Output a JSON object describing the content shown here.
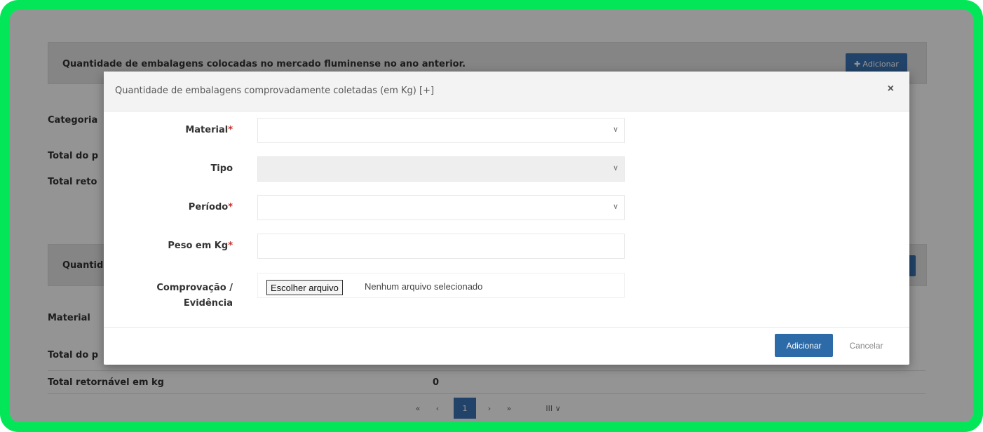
{
  "background": {
    "panel1_title": "Quantidade de embalagens colocadas no mercado fluminense no ano anterior.",
    "panel1_button": "Adicionar",
    "panel1_labels": [
      "Categoria",
      "Total do p",
      "Total reto"
    ],
    "panel2_title": "Quantid",
    "panel2_labels": [
      "Material",
      "Total do p"
    ],
    "total_retornavel_label": "Total retornável em kg",
    "total_retornavel_value": "0",
    "pagination": [
      "«",
      "‹",
      "1",
      "›",
      "»",
      "III ∨"
    ]
  },
  "modal": {
    "title": "Quantidade de embalagens comprovadamente coletadas (em Kg) [+]",
    "close": "×",
    "fields": {
      "material_label": "Material",
      "tipo_label": "Tipo",
      "periodo_label": "Período",
      "peso_label": "Peso em Kg",
      "comprovacao_label_1": "Comprovação /",
      "comprovacao_label_2": "Evidência",
      "required_mark": "*"
    },
    "file_button": "Escolher arquivo",
    "file_status": "Nenhum arquivo selecionado",
    "submit": "Adicionar",
    "cancel": "Cancelar"
  }
}
